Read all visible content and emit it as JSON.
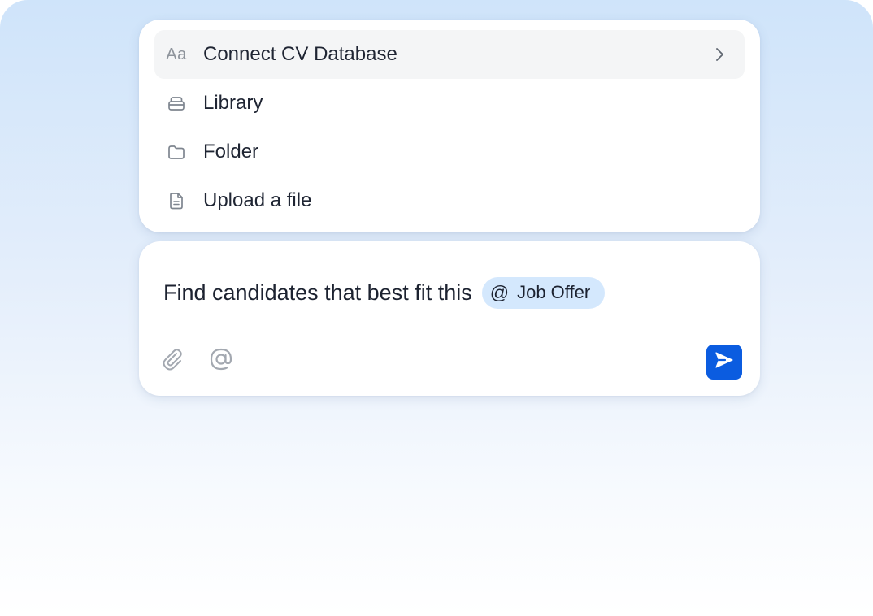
{
  "menu": {
    "items": [
      {
        "label": "Connect CV Database",
        "icon": "aa-icon",
        "icon_text": "Aa",
        "active": true,
        "has_submenu": true
      },
      {
        "label": "Library",
        "icon": "library-icon"
      },
      {
        "label": "Folder",
        "icon": "folder-icon"
      },
      {
        "label": "Upload a file",
        "icon": "file-icon"
      }
    ]
  },
  "composer": {
    "prompt_text": "Find candidates that best fit this",
    "mention": {
      "symbol": "@",
      "label": "Job Offer"
    },
    "toolbar": {
      "attach_icon": "paperclip-icon",
      "mention_icon": "at-sign-icon",
      "send_icon": "send-icon"
    }
  },
  "colors": {
    "accent": "#0b5ce0",
    "chip_bg": "#d4e8fd",
    "active_item_bg": "#f4f5f6",
    "text": "#1f2533",
    "icon_gray": "#8a9099"
  }
}
